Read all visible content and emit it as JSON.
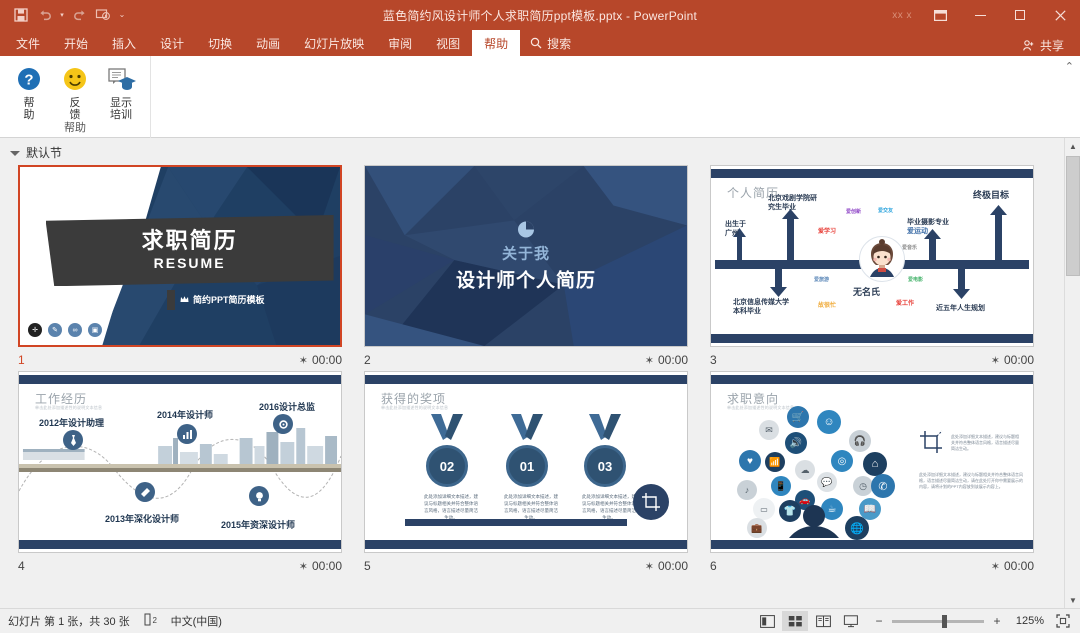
{
  "window": {
    "title": "蓝色简约风设计师个人求职简历ppt模板.pptx  -  PowerPoint",
    "user": "xx x",
    "minimize_label": "最小化",
    "restore_label": "向下还原",
    "close_label": "关闭",
    "ribbon_display_label": "功能区显示选项"
  },
  "quick_access": [
    {
      "name": "save-button",
      "icon": "save-icon",
      "label": "保存"
    },
    {
      "name": "undo-button",
      "icon": "undo-icon",
      "label": "撤消"
    },
    {
      "name": "redo-button",
      "icon": "redo-icon",
      "label": "恢复"
    },
    {
      "name": "start-slideshow-button",
      "icon": "slideshow-icon",
      "label": "从头开始"
    },
    {
      "name": "customize-qat-button",
      "icon": "chevron-down-icon",
      "label": "自定义快速访问工具栏"
    }
  ],
  "tabs": [
    {
      "label": "文件",
      "active": false
    },
    {
      "label": "开始",
      "active": false
    },
    {
      "label": "插入",
      "active": false
    },
    {
      "label": "设计",
      "active": false
    },
    {
      "label": "切换",
      "active": false
    },
    {
      "label": "动画",
      "active": false
    },
    {
      "label": "幻灯片放映",
      "active": false
    },
    {
      "label": "审阅",
      "active": false
    },
    {
      "label": "视图",
      "active": false
    },
    {
      "label": "帮助",
      "active": true
    }
  ],
  "search": {
    "label": "搜索",
    "placeholder": "搜索"
  },
  "share": {
    "label": "共享"
  },
  "ribbon": {
    "group_label": "帮助",
    "buttons": [
      {
        "label_line1": "帮",
        "label_line2": "助",
        "icon": "help-question-icon"
      },
      {
        "label_line1": "反",
        "label_line2": "馈",
        "icon": "feedback-smiley-icon"
      },
      {
        "label_line1": "显示",
        "label_line2": "培训",
        "icon": "show-training-icon"
      }
    ],
    "collapse_label": "折叠功能区"
  },
  "section": {
    "label": "默认节",
    "collapsed": false
  },
  "slides": [
    {
      "number": "1",
      "timing": "00:00",
      "selected": true,
      "title": "求职简历",
      "subtitle": "RESUME",
      "tag": "简约PPT简历模板",
      "icon_count": 4
    },
    {
      "number": "2",
      "timing": "00:00",
      "selected": false,
      "heading_small": "关于我",
      "heading_large": "设计师个人简历"
    },
    {
      "number": "3",
      "timing": "00:00",
      "selected": false,
      "title": "个人简历",
      "name_label": "无名氏",
      "milestones": [
        {
          "text": "出生于\n广州",
          "dir": "up"
        },
        {
          "text": "北京戏剧学院研\n究生毕业",
          "dir": "up"
        },
        {
          "text": "北京信息传媒大学\n本科毕业",
          "dir": "down"
        },
        {
          "text": "毕业摄影专业\n爱运动",
          "dir": "up"
        },
        {
          "text": "终极目标",
          "dir": "up"
        },
        {
          "text": "近五年人生规划",
          "dir": "down"
        }
      ],
      "chips": [
        {
          "text": "爱学习",
          "color": "#e8413a"
        },
        {
          "text": "爱创新",
          "color": "#8e44c6"
        },
        {
          "text": "爱交友",
          "color": "#2da4dd"
        },
        {
          "text": "故很忙",
          "color": "#f0ad3e"
        },
        {
          "text": "爱工作",
          "color": "#e8413a"
        },
        {
          "text": "爱电影",
          "color": "#45b36b"
        },
        {
          "text": "爱运动",
          "color": "#3f6fa8"
        },
        {
          "text": "爱旅游",
          "color": "#5b87b8"
        },
        {
          "text": "爱音乐",
          "color": "#888888"
        }
      ]
    },
    {
      "number": "4",
      "timing": "00:00",
      "selected": false,
      "title": "工作经历",
      "subtitle": "单击此处添加描述性的说明文本信息",
      "events": [
        {
          "year_label": "2012年设计助理",
          "position": "top"
        },
        {
          "year_label": "2013年深化设计师",
          "position": "bottom"
        },
        {
          "year_label": "2014年设计师",
          "position": "top"
        },
        {
          "year_label": "2015年资深设计师",
          "position": "bottom"
        },
        {
          "year_label": "2016设计总监",
          "position": "top"
        }
      ]
    },
    {
      "number": "5",
      "timing": "00:00",
      "selected": false,
      "title": "获得的奖项",
      "subtitle": "单击此处添加描述性的说明文本信息",
      "medals": [
        {
          "rank": "02",
          "text": "此处添加详细文本描述，建议与标题相关并符合整体语言风格，语言描述尽量简洁生动。"
        },
        {
          "rank": "01",
          "text": "此处添加详细文本描述，建议与标题相关并符合整体语言风格，语言描述尽量简洁生动。"
        },
        {
          "rank": "03",
          "text": "此处添加详细文本描述，建议与标题相关并符合整体语言风格，语言描述尽量简洁生动。"
        }
      ]
    },
    {
      "number": "6",
      "timing": "00:00",
      "selected": false,
      "title": "求职意向",
      "subtitle": "单击此处添加描述性的说明文本信息",
      "body1": "此处添加详细文本描述，建议与标题相关并符合整体语言风格，语言描述尽量简洁生动。",
      "body2": "此处添加详细文本描述，建议与标题相关并符合整体语言风格，语言描述尽量简洁生动，请在此处打开你中需要展示的内容，请将计划的PPT内容放到该展示内容上。"
    }
  ],
  "statusbar": {
    "slide_counter": "幻灯片 第 1 张，共 30 张",
    "accessibility_label": "辅助功能",
    "language": "中文(中国)",
    "views": [
      {
        "name": "normal-view",
        "label": "普通视图",
        "active": false
      },
      {
        "name": "slide-sorter-view",
        "label": "幻灯片浏览",
        "active": true
      },
      {
        "name": "reading-view",
        "label": "阅读视图",
        "active": false
      },
      {
        "name": "slideshow-view",
        "label": "幻灯片放映",
        "active": false
      }
    ],
    "zoom": {
      "minus": "−",
      "plus": "+",
      "percent": "125%",
      "fit_label": "使幻灯片适应当前窗口"
    }
  },
  "colors": {
    "brand": "#b7472a",
    "selection": "#d14524",
    "slide_blue": "#2b4266"
  }
}
